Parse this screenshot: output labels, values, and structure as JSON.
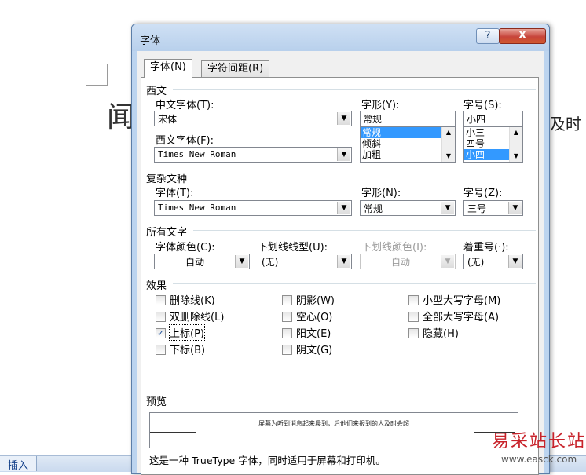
{
  "background": {
    "doc_text_left": "闻",
    "doc_text_right": "及时",
    "ribbon_tab": "插入"
  },
  "dialog": {
    "title": "字体",
    "help_label": "?",
    "close_label": "X",
    "tabs": [
      {
        "label": "字体(N)"
      },
      {
        "label": "字符间距(R)"
      }
    ],
    "western": {
      "section": "西文",
      "cn_font_label": "中文字体(T):",
      "cn_font_value": "宋体",
      "west_font_label": "西文字体(F):",
      "west_font_value": "Times New Roman",
      "style_label": "字形(Y):",
      "style_value": "常规",
      "style_options": [
        "常规",
        "倾斜",
        "加粗"
      ],
      "size_label": "字号(S):",
      "size_value": "小四",
      "size_options": [
        "小三",
        "四号",
        "小四"
      ]
    },
    "complex": {
      "section": "复杂文种",
      "font_label": "字体(T):",
      "font_value": "Times New Roman",
      "style_label": "字形(N):",
      "style_value": "常规",
      "size_label": "字号(Z):",
      "size_value": "三号"
    },
    "all_text": {
      "section": "所有文字",
      "color_label": "字体颜色(C):",
      "color_value": "自动",
      "underline_label": "下划线线型(U):",
      "underline_value": "(无)",
      "underline_color_label": "下划线颜色(I):",
      "underline_color_value": "自动",
      "emphasis_label": "着重号(·):",
      "emphasis_value": "(无)"
    },
    "effects": {
      "section": "效果",
      "strikethrough": "删除线(K)",
      "double_strike": "双删除线(L)",
      "superscript": "上标(P)",
      "subscript": "下标(B)",
      "shadow": "阴影(W)",
      "outline": "空心(O)",
      "emboss": "阳文(E)",
      "engrave": "阴文(G)",
      "small_caps": "小型大写字母(M)",
      "all_caps": "全部大写字母(A)",
      "hidden": "隐藏(H)",
      "superscript_checked": true
    },
    "preview": {
      "section": "预览",
      "sample_text": "屏幕为听到消息起来晨到，后他们来报到的人及时会超",
      "description": "这是一种 TrueType 字体，同时适用于屏幕和打印机。"
    }
  },
  "watermark": {
    "title": "易采站长站",
    "url": "www.easck.com"
  },
  "colors": {
    "selection": "#3399ff",
    "titlebar": "#b8d0ec",
    "close": "#c7443a"
  }
}
